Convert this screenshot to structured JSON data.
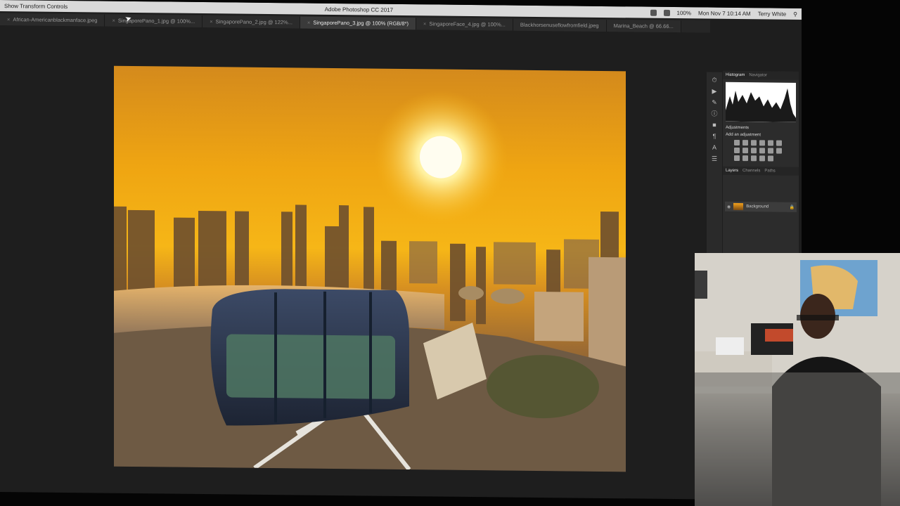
{
  "app": {
    "window_title": "Adobe Photoshop CC 2017",
    "menubar_left": "Show Transform Controls",
    "clock": "Mon Nov 7 10:14 AM",
    "user": "Terry White",
    "battery": "100%"
  },
  "tabs": [
    {
      "label": "African-Americanblackmanface.jpeg",
      "active": false
    },
    {
      "label": "SingaporePano_1.jpg @ 100%...",
      "active": false
    },
    {
      "label": "SingaporePano_2.jpg @ 122%...",
      "active": false
    },
    {
      "label": "SingaporePano_3.jpg @ 100% (RGB/8*)",
      "active": true
    },
    {
      "label": "SingaporeFace_4.jpg @ 100%...",
      "active": false
    },
    {
      "label": "Blackhorsenuseflowfromfield.jpeg",
      "active": false
    },
    {
      "label": "Marina_Beach @ 66.66...",
      "active": false
    }
  ],
  "panels": {
    "histogram_tabs": [
      "Histogram",
      "Navigator"
    ],
    "adjustments_title": "Adjustments",
    "adjustments_hint": "Add an adjustment",
    "layer_tabs": [
      "Layers",
      "Channels",
      "Paths"
    ],
    "layers": [
      {
        "name": "Background"
      }
    ]
  },
  "colors": {
    "accent": "#f6b617",
    "panel_bg": "#2c2c2c",
    "menubar": "#d9d9d9"
  },
  "icons": {
    "search": "search-icon",
    "eye": "eye-icon",
    "lock": "lock-icon",
    "wifi": "wifi-icon"
  }
}
